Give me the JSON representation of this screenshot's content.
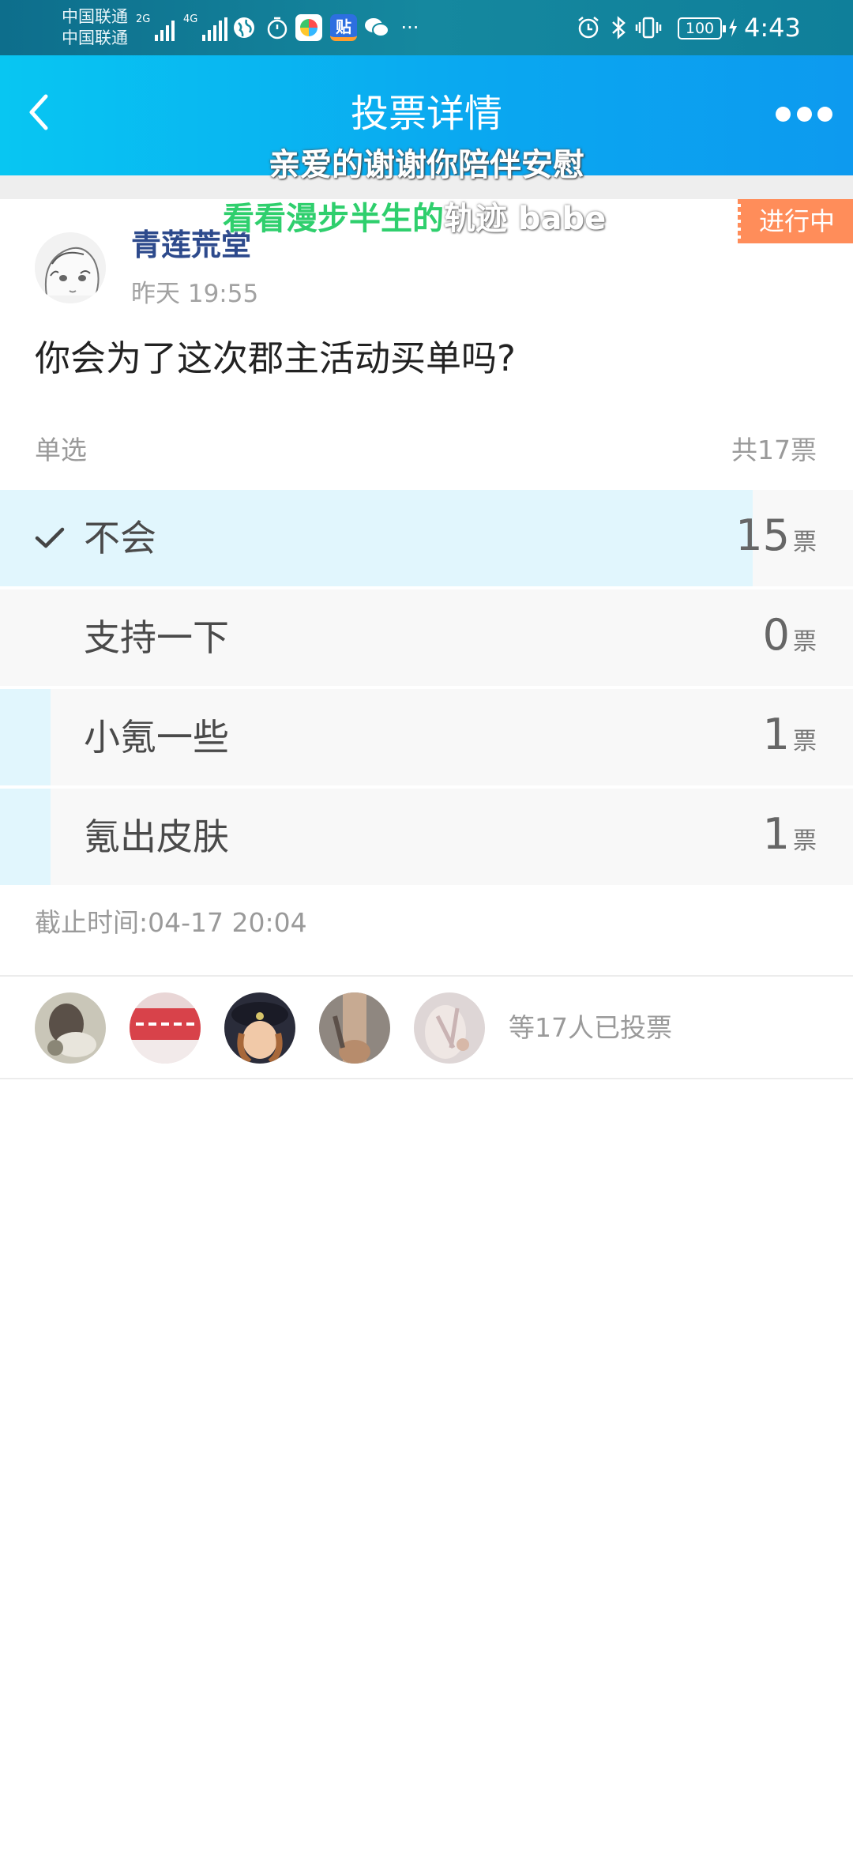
{
  "status_bar": {
    "carrier1": "中国联通",
    "carrier2": "中国联通",
    "net1": "2G",
    "net2": "4G",
    "app_badge": "贴",
    "more": "···",
    "battery": "100",
    "time": "4:43"
  },
  "nav": {
    "title": "投票详情"
  },
  "lyrics": {
    "line1": "亲爱的谢谢你陪伴安慰",
    "line2_sung": "看看漫步半生的",
    "line2_rest": "轨迹 babe"
  },
  "poll": {
    "status": "进行中",
    "author": "青莲荒堂",
    "time": "昨天 19:55",
    "question": "你会为了这次郡主活动买单吗?",
    "type": "单选",
    "total": "共17票",
    "unit": "票",
    "options": [
      {
        "label": "不会",
        "count": "15",
        "fraction": 0.882,
        "selected": true
      },
      {
        "label": "支持一下",
        "count": "0",
        "fraction": 0.0,
        "selected": false
      },
      {
        "label": "小氪一些",
        "count": "1",
        "fraction": 0.059,
        "selected": false
      },
      {
        "label": "氪出皮肤",
        "count": "1",
        "fraction": 0.059,
        "selected": false
      }
    ],
    "deadline": "截止时间:04-17 20:04",
    "voters_label": "等17人已投票"
  },
  "colors": {
    "accent": "#0aa8f0",
    "fill": "#e1f6fd",
    "tag": "#ff8d5a",
    "author": "#2d4a8c"
  }
}
